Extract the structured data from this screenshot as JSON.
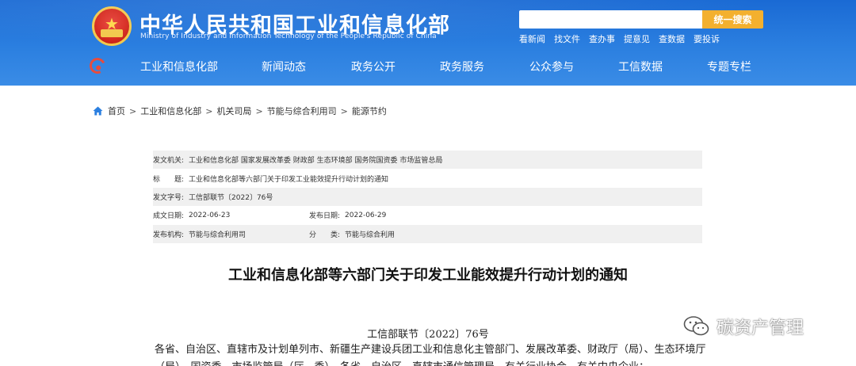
{
  "header": {
    "site_title": "中华人民共和国工业和信息化部",
    "site_subtitle": "Ministry of Industry and Information Technology of the People's Republic of China",
    "search_placeholder": "",
    "search_button": "统一搜索",
    "quick_links": [
      "看新闻",
      "找文件",
      "查办事",
      "提意见",
      "查数据",
      "要投诉"
    ],
    "colors": {
      "header_bg": "#2b7fe0",
      "search_button": "#f3b02e",
      "accent_red": "#e84c3d"
    }
  },
  "nav": {
    "items": [
      "工业和信息化部",
      "新闻动态",
      "政务公开",
      "政务服务",
      "公众参与",
      "工信数据",
      "专题专栏"
    ]
  },
  "breadcrumb": {
    "items": [
      "首页",
      "工业和信息化部",
      "机关司局",
      "节能与综合利用司",
      "能源节约"
    ],
    "separator": ">"
  },
  "info": {
    "issuer_label": "发文机关:",
    "issuer_value": "工业和信息化部 国家发展改革委 财政部 生态环境部 国务院国资委 市场监管总局",
    "title_label": "标　　题:",
    "title_value": "工业和信息化部等六部门关于印发工业能效提升行动计划的通知",
    "docno_label": "发文字号:",
    "docno_value": "工信部联节〔2022〕76号",
    "created_label": "成文日期:",
    "created_value": "2022-06-23",
    "published_label": "发布日期:",
    "published_value": "2022-06-29",
    "agency_label": "发布机构:",
    "agency_value": "节能与综合利用司",
    "category_label": "分　　类:",
    "category_value": "节能与综合利用"
  },
  "article": {
    "title": "工业和信息化部等六部门关于印发工业能效提升行动计划的通知",
    "doc_number": "工信部联节〔2022〕76号",
    "body_line1": "各省、自治区、直辖市及计划单列市、新疆生产建设兵团工业和信息化主管部门、发展改革委、财政厅（局）、生态环境厅",
    "body_line2": "（局）、国资委、市场监管局（厅、委），各省、自治区、直辖市通信管理局，有关行业协会，有关中央企业："
  },
  "watermark": {
    "text": "碳资产管理",
    "icon": "wechat-icon"
  }
}
